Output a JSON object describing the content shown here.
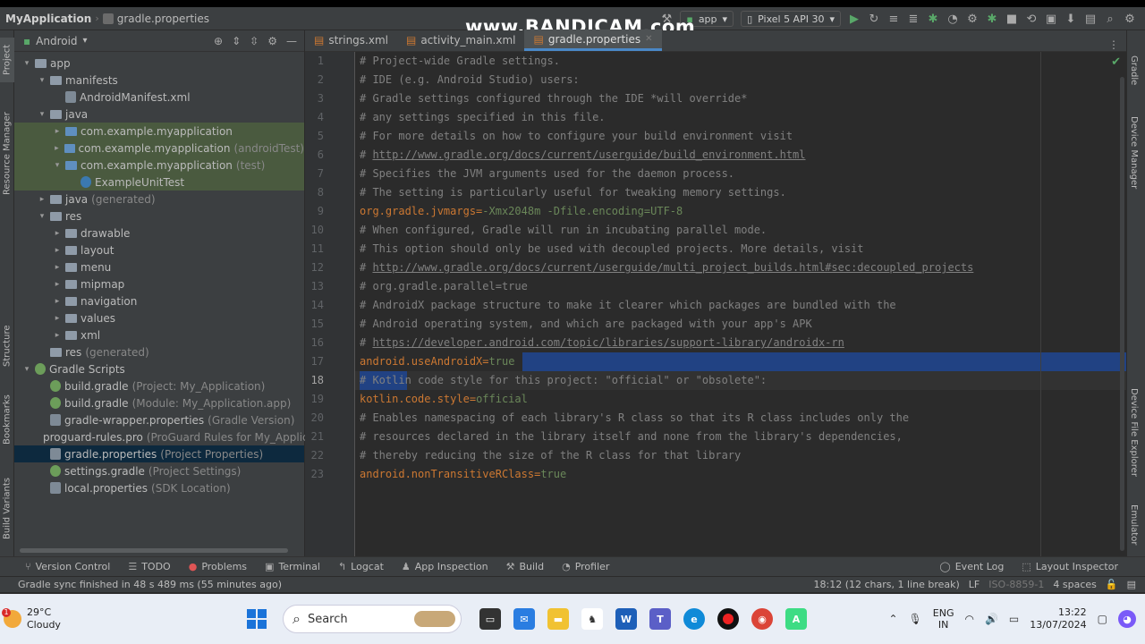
{
  "titlebar": {
    "app": "MyApplication",
    "file": "gradle.properties",
    "run_config": "app",
    "device": "Pixel 5 API 30"
  },
  "watermark": {
    "prefix": "www.",
    "brand": "BANDICAM",
    "suffix": ".com"
  },
  "left_strip": {
    "project": "Project",
    "resource_manager": "Resource Manager",
    "structure": "Structure",
    "bookmarks": "Bookmarks",
    "build_variants": "Build Variants"
  },
  "right_strip": {
    "gradle": "Gradle",
    "device_manager": "Device Manager",
    "device_file_explorer": "Device File Explorer",
    "emulator": "Emulator"
  },
  "project": {
    "view": "Android",
    "tree": [
      {
        "indent": 0,
        "arrow": "▾",
        "icon": "folder",
        "label": "app",
        "note": ""
      },
      {
        "indent": 1,
        "arrow": "▾",
        "icon": "folder",
        "label": "manifests",
        "note": ""
      },
      {
        "indent": 2,
        "arrow": "",
        "icon": "file",
        "label": "AndroidManifest.xml",
        "note": ""
      },
      {
        "indent": 1,
        "arrow": "▾",
        "icon": "folder",
        "label": "java",
        "note": ""
      },
      {
        "indent": 2,
        "arrow": "▸",
        "icon": "pkg",
        "label": "com.example.myapplication",
        "note": "",
        "hl": true
      },
      {
        "indent": 2,
        "arrow": "▸",
        "icon": "pkg",
        "label": "com.example.myapplication",
        "note": "(androidTest)",
        "hl": true
      },
      {
        "indent": 2,
        "arrow": "▾",
        "icon": "pkg",
        "label": "com.example.myapplication",
        "note": "(test)",
        "hl": true
      },
      {
        "indent": 3,
        "arrow": "",
        "icon": "class",
        "label": "ExampleUnitTest",
        "note": "",
        "hl": true
      },
      {
        "indent": 1,
        "arrow": "▸",
        "icon": "folder",
        "label": "java",
        "note": "(generated)"
      },
      {
        "indent": 1,
        "arrow": "▾",
        "icon": "folder",
        "label": "res",
        "note": ""
      },
      {
        "indent": 2,
        "arrow": "▸",
        "icon": "folder",
        "label": "drawable",
        "note": ""
      },
      {
        "indent": 2,
        "arrow": "▸",
        "icon": "folder",
        "label": "layout",
        "note": ""
      },
      {
        "indent": 2,
        "arrow": "▸",
        "icon": "folder",
        "label": "menu",
        "note": ""
      },
      {
        "indent": 2,
        "arrow": "▸",
        "icon": "folder",
        "label": "mipmap",
        "note": ""
      },
      {
        "indent": 2,
        "arrow": "▸",
        "icon": "folder",
        "label": "navigation",
        "note": ""
      },
      {
        "indent": 2,
        "arrow": "▸",
        "icon": "folder",
        "label": "values",
        "note": ""
      },
      {
        "indent": 2,
        "arrow": "▸",
        "icon": "folder",
        "label": "xml",
        "note": ""
      },
      {
        "indent": 1,
        "arrow": "",
        "icon": "folder",
        "label": "res",
        "note": "(generated)"
      },
      {
        "indent": 0,
        "arrow": "▾",
        "icon": "gradle",
        "label": "Gradle Scripts",
        "note": ""
      },
      {
        "indent": 1,
        "arrow": "",
        "icon": "gradle",
        "label": "build.gradle",
        "note": "(Project: My_Application)"
      },
      {
        "indent": 1,
        "arrow": "",
        "icon": "gradle",
        "label": "build.gradle",
        "note": "(Module: My_Application.app)"
      },
      {
        "indent": 1,
        "arrow": "",
        "icon": "file",
        "label": "gradle-wrapper.properties",
        "note": "(Gradle Version)"
      },
      {
        "indent": 1,
        "arrow": "",
        "icon": "file",
        "label": "proguard-rules.pro",
        "note": "(ProGuard Rules for My_Applicati"
      },
      {
        "indent": 1,
        "arrow": "",
        "icon": "file",
        "label": "gradle.properties",
        "note": "(Project Properties)",
        "sel": true
      },
      {
        "indent": 1,
        "arrow": "",
        "icon": "gradle",
        "label": "settings.gradle",
        "note": "(Project Settings)"
      },
      {
        "indent": 1,
        "arrow": "",
        "icon": "file",
        "label": "local.properties",
        "note": "(SDK Location)"
      }
    ]
  },
  "tabs": [
    {
      "label": "strings.xml",
      "active": false
    },
    {
      "label": "activity_main.xml",
      "active": false
    },
    {
      "label": "gradle.properties",
      "active": true
    }
  ],
  "editor": {
    "lines": [
      {
        "n": "1",
        "parts": [
          [
            "c",
            "# Project-wide Gradle settings."
          ]
        ]
      },
      {
        "n": "2",
        "parts": [
          [
            "c",
            "# IDE (e.g. Android Studio) users:"
          ]
        ]
      },
      {
        "n": "3",
        "parts": [
          [
            "c",
            "# Gradle settings configured through the IDE *will override*"
          ]
        ]
      },
      {
        "n": "4",
        "parts": [
          [
            "c",
            "# any settings specified in this file."
          ]
        ]
      },
      {
        "n": "5",
        "parts": [
          [
            "c",
            "# For more details on how to configure your build environment visit"
          ]
        ]
      },
      {
        "n": "6",
        "parts": [
          [
            "c",
            "# "
          ],
          [
            "u",
            "http://www.gradle.org/docs/current/userguide/build_environment.html"
          ]
        ]
      },
      {
        "n": "7",
        "parts": [
          [
            "c",
            "# Specifies the JVM arguments used for the daemon process."
          ]
        ]
      },
      {
        "n": "8",
        "parts": [
          [
            "c",
            "# The setting is particularly useful for tweaking memory settings."
          ]
        ]
      },
      {
        "n": "9",
        "parts": [
          [
            "k",
            "org.gradle.jvmargs"
          ],
          [
            "e",
            "="
          ],
          [
            "v",
            "-Xmx2048m -Dfile.encoding=UTF-8"
          ]
        ]
      },
      {
        "n": "10",
        "parts": [
          [
            "c",
            "# When configured, Gradle will run in incubating parallel mode."
          ]
        ]
      },
      {
        "n": "11",
        "parts": [
          [
            "c",
            "# This option should only be used with decoupled projects. More details, visit"
          ]
        ]
      },
      {
        "n": "12",
        "parts": [
          [
            "c",
            "# "
          ],
          [
            "u",
            "http://www.gradle.org/docs/current/userguide/multi_project_builds.html#sec:decoupled_projects"
          ]
        ]
      },
      {
        "n": "13",
        "parts": [
          [
            "c",
            "# org.gradle.parallel=true"
          ]
        ]
      },
      {
        "n": "14",
        "parts": [
          [
            "c",
            "# AndroidX package structure to make it clearer which packages are bundled with the"
          ]
        ]
      },
      {
        "n": "15",
        "parts": [
          [
            "c",
            "# Android operating system, and which are packaged with your app's APK"
          ]
        ]
      },
      {
        "n": "16",
        "parts": [
          [
            "c",
            "# "
          ],
          [
            "u",
            "https://developer.android.com/topic/libraries/support-library/androidx-rn"
          ]
        ]
      },
      {
        "n": "17",
        "parts": [
          [
            "k",
            "android.useAndroidX"
          ],
          [
            "e",
            "="
          ],
          [
            "v",
            "true"
          ]
        ]
      },
      {
        "n": "18",
        "parts": [
          [
            "c",
            "# Kotlin code style for this project: \"official\" or \"obsolete\":"
          ]
        ]
      },
      {
        "n": "19",
        "parts": [
          [
            "k",
            "kotlin.code.style"
          ],
          [
            "e",
            "="
          ],
          [
            "v",
            "official"
          ]
        ]
      },
      {
        "n": "20",
        "parts": [
          [
            "c",
            "# Enables namespacing of each library's R class so that its R class includes only the"
          ]
        ]
      },
      {
        "n": "21",
        "parts": [
          [
            "c",
            "# resources declared in the library itself and none from the library's dependencies,"
          ]
        ]
      },
      {
        "n": "22",
        "parts": [
          [
            "c",
            "# thereby reducing the size of the R class for that library"
          ]
        ]
      },
      {
        "n": "23",
        "parts": [
          [
            "k",
            "android.nonTransitiveRClass"
          ],
          [
            "e",
            "="
          ],
          [
            "v",
            "true"
          ]
        ]
      }
    ],
    "current_line": "18"
  },
  "toolwindows": {
    "version_control": "Version Control",
    "todo": "TODO",
    "problems": "Problems",
    "terminal": "Terminal",
    "logcat": "Logcat",
    "app_inspection": "App Inspection",
    "build": "Build",
    "profiler": "Profiler",
    "event_log": "Event Log",
    "layout_inspector": "Layout Inspector"
  },
  "status": {
    "message": "Gradle sync finished in 48 s 489 ms (55 minutes ago)",
    "position": "18:12 (12 chars, 1 line break)",
    "line_sep": "LF",
    "encoding": "ISO-8859-1",
    "indent": "4 spaces"
  },
  "taskbar": {
    "temp": "29°C",
    "weather": "Cloudy",
    "badge": "1",
    "search": "Search",
    "lang1": "ENG",
    "lang2": "IN",
    "time": "13:22",
    "date": "13/07/2024"
  }
}
